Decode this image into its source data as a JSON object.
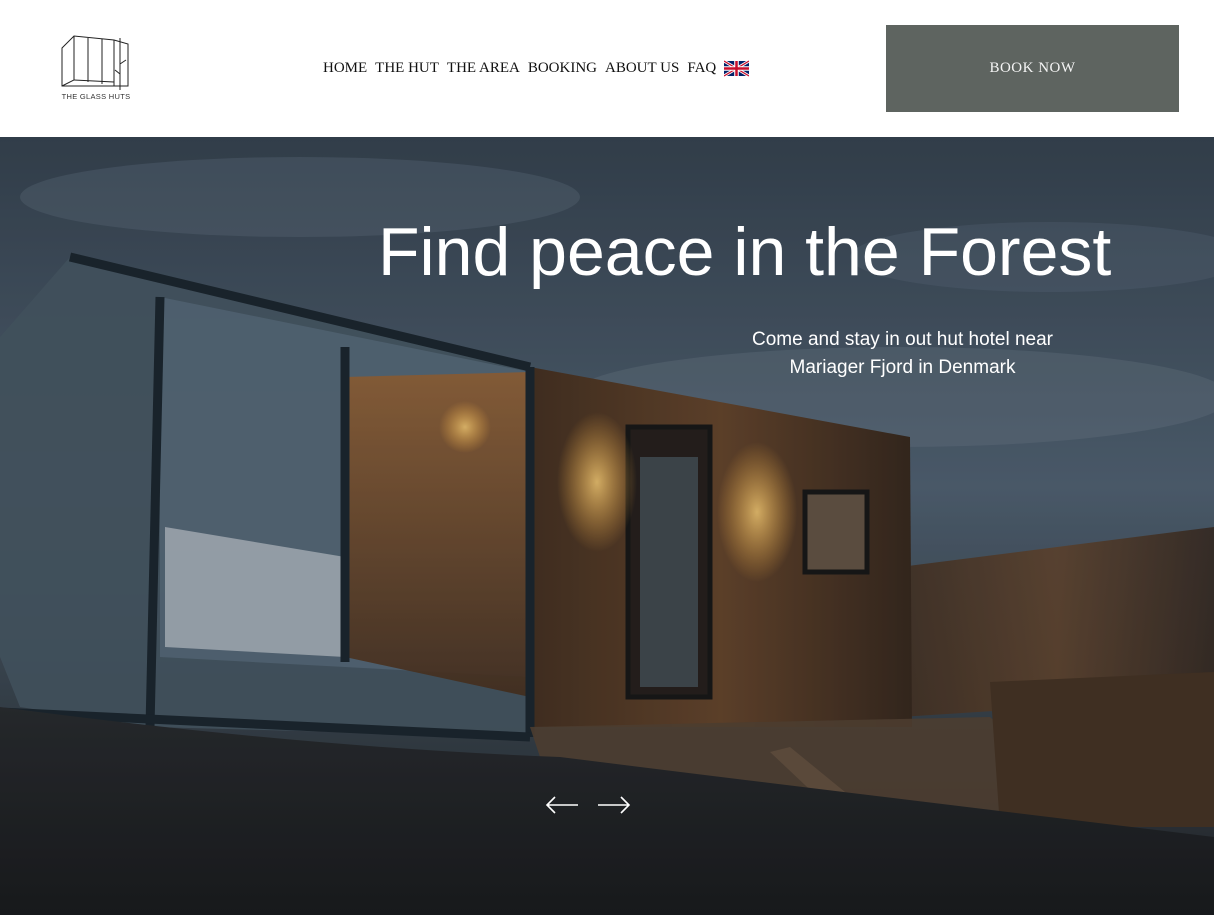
{
  "brand": {
    "logo_text": "THE GLASS HUTS"
  },
  "nav": {
    "items": [
      "HOME",
      "THE HUT",
      "THE AREA",
      "BOOKING",
      "ABOUT US",
      "FAQ"
    ],
    "language_icon": "uk-flag-icon"
  },
  "cta": {
    "book_label": "BOOK NOW",
    "color": "#5e6460"
  },
  "hero": {
    "title": "Find peace in the Forest",
    "subtitle_line1": "Come and stay in out hut hotel near",
    "subtitle_line2": "Mariager Fjord in Denmark",
    "prev_icon": "arrow-left-icon",
    "next_icon": "arrow-right-icon"
  }
}
